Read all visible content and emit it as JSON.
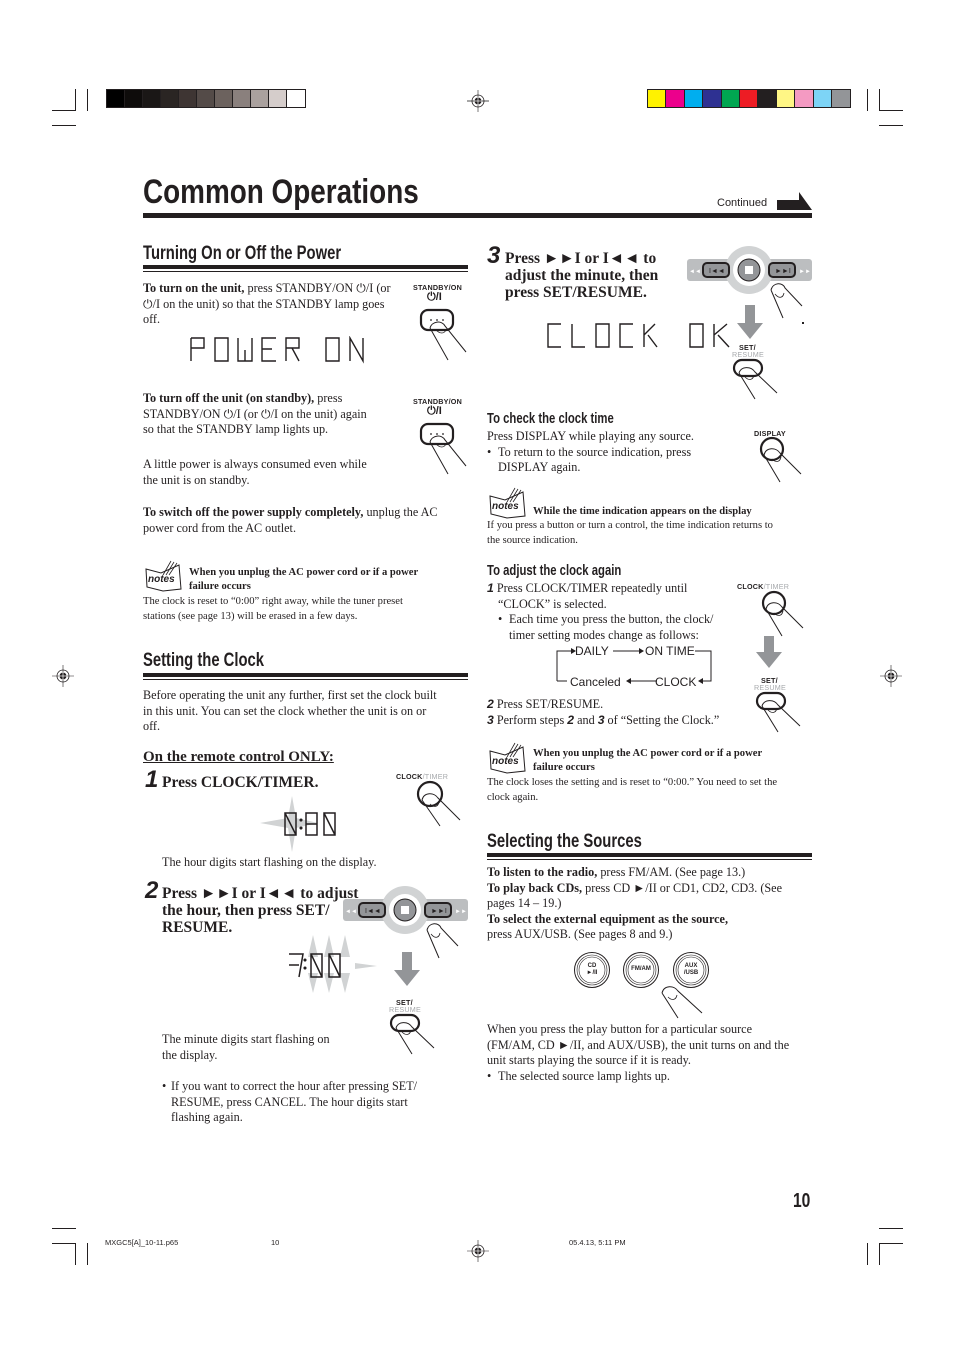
{
  "print_marks": {
    "gray_swatches": [
      "#000000",
      "#0e0c0b",
      "#1a1716",
      "#2a2523",
      "#3e3533",
      "#544b48",
      "#6c625e",
      "#8a807d",
      "#aaa19e",
      "#d5cdcb",
      "#ffffff"
    ],
    "color_swatches": [
      "#fff200",
      "#ec008c",
      "#00aeef",
      "#2e3192",
      "#00a651",
      "#ed1c24",
      "#231f20",
      "#fff685",
      "#f49ac2",
      "#7dd4f6",
      "#939598"
    ],
    "footer": {
      "filename": "MXGC5[A]_10-11.p65",
      "page": "10",
      "timestamp": "05.4.13, 5:11 PM"
    }
  },
  "header": {
    "title": "Common Operations",
    "continued": "Continued"
  },
  "page_number": "10",
  "power": {
    "heading": "Turning On or Off the Power",
    "turn_on_bold": "To turn on the unit,",
    "turn_on_line1": " press STANDBY/ON ⏻/I (or",
    "turn_on_line2": "⏻/I on the unit) so that the STANDBY lamp goes",
    "turn_on_line3": "off.",
    "button_label": "STANDBY/ON",
    "button_symbol": "⏻/I",
    "display_on": "POWER  ON",
    "turn_off_bold": "To turn off the unit (on standby),",
    "turn_off_line1": " press",
    "turn_off_line2": "STANDBY/ON ⏻/I (or  ⏻/I on the unit) again",
    "turn_off_line3": "so that the STANDBY lamp lights up.",
    "standby_note_line1": "A little power is always consumed even while",
    "standby_note_line2": "the unit is on standby.",
    "switch_off_bold": "To switch off the power supply completely,",
    "switch_off_rest": " unplug the AC",
    "switch_off_line2": "power cord from the AC outlet.",
    "notes": {
      "icon_label": "notes",
      "title_line1": "When you unplug the AC power cord or if a power",
      "title_line2": "failure occurs",
      "body_line1": "The clock is reset to “0:00” right away, while the tuner preset",
      "body_line2": "stations (see page 13) will be erased in a few days."
    }
  },
  "clock": {
    "heading": "Setting the Clock",
    "intro_line1": "Before operating the unit any further, first set the clock built",
    "intro_line2": "in this unit. You can set the clock whether the unit is on or",
    "intro_line3": "off.",
    "remote_only": "On the remote control ONLY:",
    "steps": [
      {
        "num": "1",
        "title": "Press CLOCK/TIMER.",
        "button_label_a": "CLOCK",
        "button_label_b": "/TIMER",
        "display": "0:00",
        "caption": "The hour digits start flashing on the display."
      },
      {
        "num": "2",
        "title_line1": "Press ►►I or I◄◄ to adjust",
        "title_line2": "the hour, then press SET/",
        "title_line3": "RESUME.",
        "display": "7:00",
        "set_label": "SET/",
        "resume_label": "RESUME",
        "caption_line1": "The minute digits start flashing on",
        "caption_line2": "the display.",
        "bullet_line1": "If you want to correct the hour after pressing SET/",
        "bullet_line2": "RESUME, press CANCEL. The hour digits start",
        "bullet_line3": "flashing again."
      },
      {
        "num": "3",
        "title_line1": "Press ►►I or I◄◄ to",
        "title_line2": "adjust the minute, then",
        "title_line3": "press SET/RESUME.",
        "display": "CLOCK  OK",
        "set_label": "SET/",
        "resume_label": "RESUME"
      }
    ],
    "check": {
      "heading": "To check the clock time",
      "line1": "Press DISPLAY while playing any source.",
      "bullet_line1": "To return to the source indication, press",
      "bullet_line2": "DISPLAY again.",
      "button_label": "DISPLAY",
      "notes": {
        "icon_label": "notes",
        "title": "While the time indication appears on the display",
        "body_line1": "If you press a button or turn a control, the time indication returns to",
        "body_line2": "the source indication."
      }
    },
    "adjust_again": {
      "heading": "To adjust the clock again",
      "step1_num": "1",
      "step1_line1": "Press CLOCK/TIMER repeatedly until",
      "step1_line2": "“CLOCK” is selected.",
      "bullet_line1": "Each time you press the button, the clock/",
      "bullet_line2": "timer setting modes change as follows:",
      "cycle": [
        "DAILY",
        "ON TIME",
        "CLOCK",
        "Canceled"
      ],
      "step2_num": "2",
      "step2": "Press SET/RESUME.",
      "step3_num": "3",
      "step3_pre": "Perform steps ",
      "step3_a": "2",
      "step3_mid": " and ",
      "step3_b": "3",
      "step3_post": " of “Setting the Clock.”",
      "clock_label_a": "CLOCK",
      "clock_label_b": "/TIMER",
      "set_label": "SET/",
      "resume_label": "RESUME",
      "notes": {
        "icon_label": "notes",
        "title_line1": "When you unplug the AC power cord or if a power",
        "title_line2": "failure occurs",
        "body_line1": "The clock loses the setting and is reset to “0:00.” You need to set the",
        "body_line2": "clock again."
      }
    }
  },
  "sources": {
    "heading": "Selecting the Sources",
    "radio_bold": "To listen to the radio,",
    "radio_rest": " press FM/AM. (See page 13.)",
    "cd_bold": "To play back CDs,",
    "cd_rest": " press CD ►/II or CD1, CD2, CD3. (See",
    "cd_line2": "pages 14 – 19.)",
    "ext_bold": "To select the external equipment as the source,",
    "ext_line2": "press AUX/USB. (See pages 8 and 9.)",
    "buttons": [
      {
        "line1": "CD",
        "line2": "►/II"
      },
      {
        "line1": "FM/AM",
        "line2": ""
      },
      {
        "line1": "AUX",
        "line2": "/USB"
      }
    ],
    "play_line1": "When you press the play button for a particular source",
    "play_line2": "(FM/AM, CD ►/II, and AUX/USB), the unit turns on and the",
    "play_line3": "unit starts playing the source if it is ready.",
    "bullet": "The selected source lamp lights up."
  }
}
